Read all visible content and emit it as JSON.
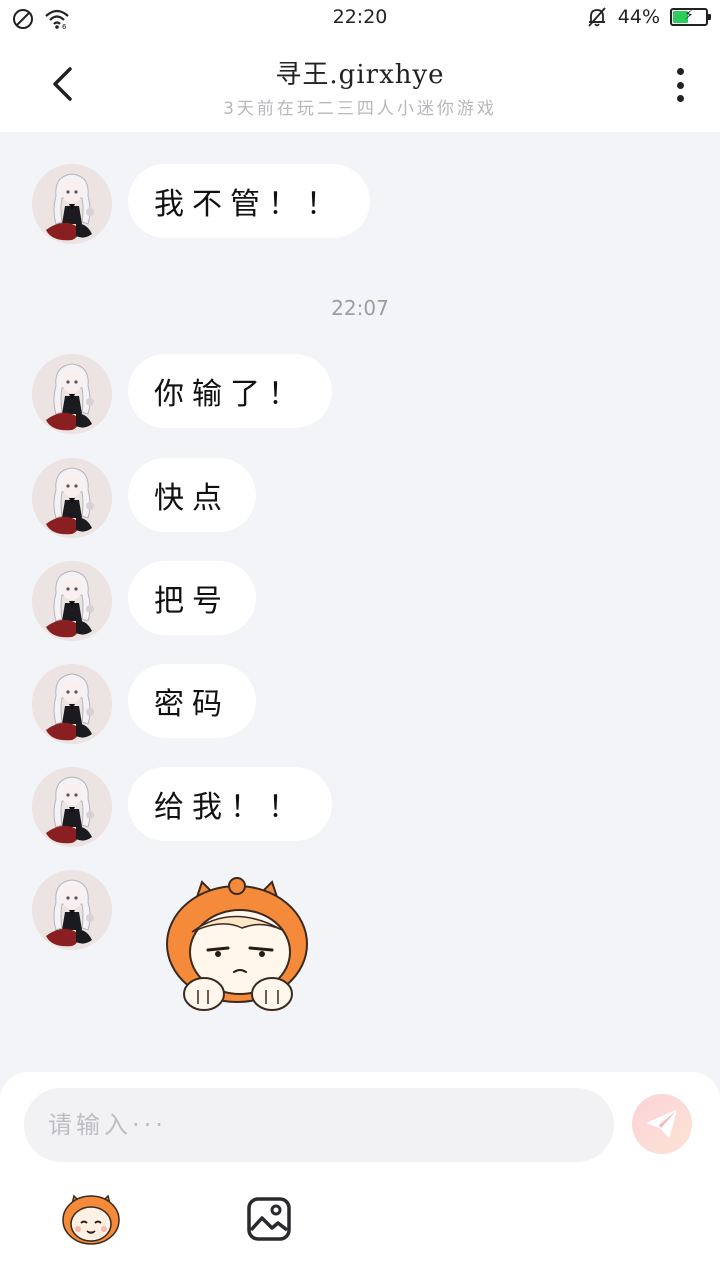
{
  "status_bar": {
    "time": "22:20",
    "battery_percent": "44%",
    "battery_level": 0.44,
    "icons": [
      "dnd-icon",
      "wifi-icon",
      "bell-off-icon",
      "battery-icon"
    ]
  },
  "header": {
    "title": "寻王.girxhye",
    "subtitle": "3天前在玩二三四人小迷你游戏"
  },
  "messages": [
    {
      "type": "text",
      "text": "我不管！！"
    },
    {
      "type": "timestamp",
      "text": "22:07"
    },
    {
      "type": "text",
      "text": "你输了！"
    },
    {
      "type": "text",
      "text": "快点"
    },
    {
      "type": "text",
      "text": "把号"
    },
    {
      "type": "text",
      "text": "密码"
    },
    {
      "type": "text",
      "text": "给我！！"
    },
    {
      "type": "sticker",
      "icon": "grumpy-mascot-sticker"
    }
  ],
  "input": {
    "placeholder": "请输入···"
  },
  "toolbar": {
    "icons": [
      "sticker-icon",
      "image-icon",
      "send-icon"
    ]
  },
  "colors": {
    "background": "#f3f4f8",
    "bubble": "#ffffff",
    "send_button": "#fbd3d6",
    "mascot_orange": "#f58a3a"
  }
}
